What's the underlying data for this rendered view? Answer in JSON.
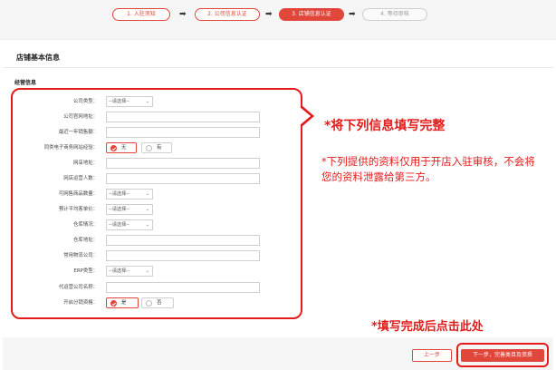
{
  "steps": [
    {
      "label": "1. 入驻须知",
      "state": "done"
    },
    {
      "label": "2. 公司信息认证",
      "state": "done"
    },
    {
      "label": "3. 店铺信息认证",
      "state": "active"
    },
    {
      "label": "4. 等待审核",
      "state": "todo"
    }
  ],
  "section": {
    "title": "店铺基本信息",
    "subtitle": "经营信息"
  },
  "form": {
    "company_type": {
      "label": "公司类型：",
      "value": "--请选择--"
    },
    "website": {
      "label": "公司官网地址：",
      "value": ""
    },
    "annual_sales": {
      "label": "最近一年销售额：",
      "value": ""
    },
    "ecommerce_experience": {
      "label": "同类电子商务网站经验：",
      "options": [
        "无",
        "有"
      ],
      "selected": "无"
    },
    "shop_url": {
      "label": "网店地址：",
      "value": ""
    },
    "operators": {
      "label": "网店运营人数：",
      "value": ""
    },
    "sku_count": {
      "label": "可网售商品数量：",
      "value": "--请选择--"
    },
    "avg_price": {
      "label": "预计平均客单价：",
      "value": "--请选择--"
    },
    "warehouse_status": {
      "label": "仓库情况：",
      "value": "--请选择--"
    },
    "warehouse_address": {
      "label": "仓库地址：",
      "value": ""
    },
    "logistics": {
      "label": "常用物流公司：",
      "value": ""
    },
    "erp_type": {
      "label": "ERP类型：",
      "value": "--请选择--"
    },
    "agency_name": {
      "label": "代运营公司名称：",
      "value": ""
    },
    "distribution": {
      "label": "开启分销资格：",
      "options": [
        "是",
        "否"
      ],
      "selected": "是"
    }
  },
  "notes": {
    "main": "*将下列信息填写完整",
    "sub": "*下列提供的资料仅用于开店入驻审核，不会将您的资料泄露给第三方。",
    "click": "*填写完成后点击此处"
  },
  "buttons": {
    "prev": "上一步",
    "next": "下一步，完善类目及资质"
  },
  "colors": {
    "accent": "#e0463a",
    "annotation": "#e51b1b"
  }
}
